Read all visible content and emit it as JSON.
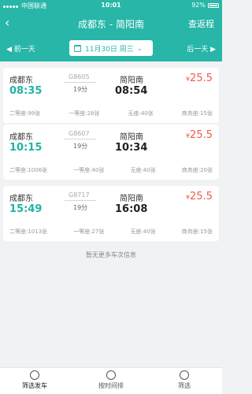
{
  "status_bar": {
    "carrier": "中国联通",
    "time": "10:01",
    "battery": "92%"
  },
  "nav": {
    "title": "成都东 - 简阳南",
    "return_label": "查返程"
  },
  "date_bar": {
    "prev_label": "前一天",
    "next_label": "后一天",
    "date": "11月30日 周三"
  },
  "trains": [
    {
      "from": "成都东",
      "depart_time": "08:35",
      "train_no": "G8605",
      "duration": "19分",
      "to": "简阳南",
      "arrive_time": "08:54",
      "price": "25.5",
      "seats": [
        "二等座:99张",
        "一等座:28张",
        "无座:40张",
        "商务座:15张"
      ]
    },
    {
      "from": "成都东",
      "depart_time": "10:15",
      "train_no": "G8607",
      "duration": "19分",
      "to": "简阳南",
      "arrive_time": "10:34",
      "price": "25.5",
      "seats": [
        "二等座:1006张",
        "一等座:40张",
        "无座:40张",
        "商务座:20张"
      ]
    },
    {
      "from": "成都东",
      "depart_time": "15:49",
      "train_no": "G8717",
      "duration": "19分",
      "to": "简阳南",
      "arrive_time": "16:08",
      "price": "25.5",
      "seats": [
        "二等座:1013张",
        "一等座:27张",
        "无座:40张",
        "商务座:15张"
      ]
    }
  ],
  "more_label": "暂无更多车次信息",
  "tabs": [
    {
      "label": "筛选发车",
      "icon": "filter-icon"
    },
    {
      "label": "按时间排",
      "icon": "clock-icon"
    },
    {
      "label": "筛选",
      "icon": "funnel-icon"
    }
  ],
  "colors": {
    "brand": "#27b6a8",
    "depart_time": "#22b3a3",
    "price": "#f05a4f"
  }
}
